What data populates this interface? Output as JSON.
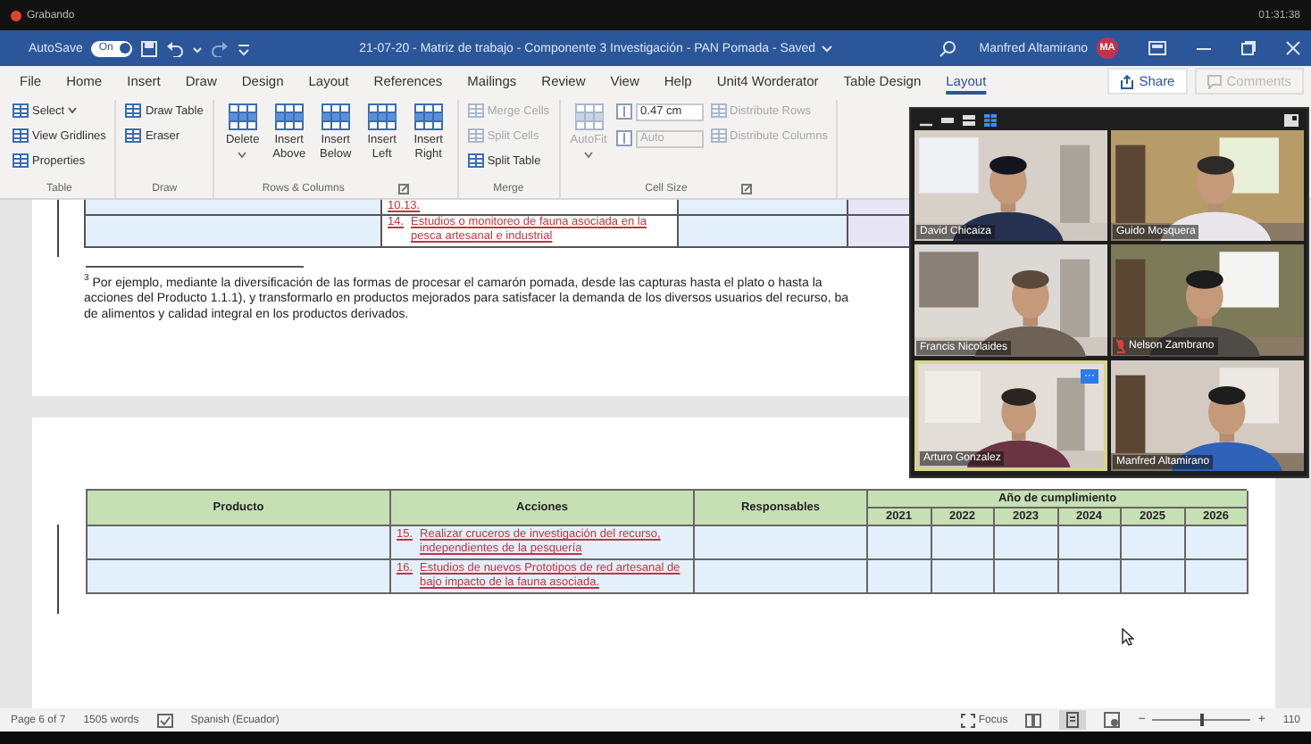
{
  "recording": {
    "label": "Grabando",
    "clock": "01:31:38"
  },
  "title_bar": {
    "autosave": {
      "label": "AutoSave",
      "toggle": "On",
      "on": true
    },
    "title": "21-07-20 - Matriz de trabajo - Componente 3 Investigación - PAN Pomada - Saved",
    "user": "Manfred Altamirano",
    "avatar": "MA"
  },
  "tabs": [
    {
      "label": "File",
      "selected": false
    },
    {
      "label": "Home",
      "selected": false
    },
    {
      "label": "Insert",
      "selected": false
    },
    {
      "label": "Draw",
      "selected": false
    },
    {
      "label": "Design",
      "selected": false
    },
    {
      "label": "Layout",
      "selected": false
    },
    {
      "label": "References",
      "selected": false
    },
    {
      "label": "Mailings",
      "selected": false
    },
    {
      "label": "Review",
      "selected": false
    },
    {
      "label": "View",
      "selected": false
    },
    {
      "label": "Help",
      "selected": false
    },
    {
      "label": "Unit4 Worderator",
      "selected": false
    },
    {
      "label": "Table Design",
      "selected": false
    },
    {
      "label": "Layout",
      "selected": true
    }
  ],
  "share": {
    "label": "Share"
  },
  "comments": {
    "label": "Comments",
    "disabled": true
  },
  "ribbon_groups": [
    {
      "label": "Table",
      "columns": [
        [
          {
            "kind": "small",
            "label": "Select",
            "menu": true,
            "disabled": false
          },
          {
            "kind": "small",
            "label": "View Gridlines",
            "disabled": false
          },
          {
            "kind": "small",
            "label": "Properties",
            "disabled": false
          }
        ]
      ]
    },
    {
      "label": "Draw",
      "columns": [
        [
          {
            "kind": "small",
            "label": "Draw Table",
            "disabled": false
          },
          {
            "kind": "small",
            "label": "Eraser",
            "disabled": false
          }
        ]
      ]
    },
    {
      "label": "Rows & Columns",
      "launcher": true,
      "columns": [
        [
          {
            "kind": "large",
            "label": "Delete",
            "menu": true,
            "disabled": false
          }
        ],
        [
          {
            "kind": "large",
            "label": "Insert Above",
            "disabled": false
          }
        ],
        [
          {
            "kind": "large",
            "label": "Insert Below",
            "disabled": false
          }
        ],
        [
          {
            "kind": "large",
            "label": "Insert Left",
            "disabled": false
          }
        ],
        [
          {
            "kind": "large",
            "label": "Insert Right",
            "disabled": false
          }
        ]
      ]
    },
    {
      "label": "Merge",
      "columns": [
        [
          {
            "kind": "small",
            "label": "Merge Cells",
            "disabled": true
          },
          {
            "kind": "small",
            "label": "Split Cells",
            "disabled": true
          },
          {
            "kind": "small",
            "label": "Split Table",
            "disabled": false
          }
        ]
      ]
    },
    {
      "label": "Cell Size",
      "launcher": true,
      "columns": [
        [
          {
            "kind": "large",
            "label": "AutoFit",
            "menu": true,
            "disabled": true
          }
        ],
        [
          {
            "kind": "field",
            "label": "0.47 cm",
            "disabled": false
          },
          {
            "kind": "field",
            "label": "Auto",
            "disabled": true
          }
        ],
        [
          {
            "kind": "small",
            "label": "Distribute Rows",
            "disabled": true
          },
          {
            "kind": "small",
            "label": "Distribute Columns",
            "disabled": true
          }
        ]
      ]
    }
  ],
  "page_fragment": {
    "rows": [
      {
        "number": "10.13."
      },
      {
        "number": "14.",
        "text": "Estudios o monitoreo de fauna asociada en la pesca artesanal e industrial"
      }
    ],
    "footnote": [
      "$^{3}$ Por ejemplo, mediante la diversificación de las formas de procesar el camarón pomada, desde las capturas hasta el plato o hasta la",
      "acciones del Producto 1.1.1), y transformarlo en productos mejorados para satisfacer la demanda de los diversos usuarios del recurso, ba",
      "de alimentos y calidad integral en los productos derivados."
    ]
  },
  "table": {
    "columns": [
      "Producto",
      "Acciones",
      "Responsables"
    ],
    "year_group": "Año de cumplimiento",
    "years": [
      "2021",
      "2022",
      "2023",
      "2024",
      "2025",
      "2026"
    ],
    "rows": [
      {
        "number": "15.",
        "action": "Realizar cruceros de investigación del recurso, independientes de la pesquería"
      },
      {
        "number": "16.",
        "action": "Estudios de nuevos Prototipos de red artesanal de bajo impacto de la fauna asociada."
      }
    ]
  },
  "video_call": {
    "tiles": [
      {
        "name": "David Chicaiza",
        "muted": false,
        "highlighted": false
      },
      {
        "name": "Guido Mosquera",
        "muted": false,
        "highlighted": false
      },
      {
        "name": "Francis Nicolaides",
        "muted": false,
        "highlighted": false
      },
      {
        "name": "Nelson Zambrano",
        "muted": true,
        "highlighted": false
      },
      {
        "name": "Arturo Gonzalez",
        "muted": false,
        "highlighted": true,
        "more": "···"
      },
      {
        "name": "Manfred Altamirano",
        "muted": false,
        "highlighted": false
      }
    ]
  },
  "status_bar": {
    "page": "Page 6 of 7",
    "words": "1505 words",
    "language": "Spanish (Ecuador)",
    "focus": "Focus",
    "zoom": {
      "minus": "−",
      "plus": "+",
      "level": 0.5,
      "reading": "110"
    }
  }
}
